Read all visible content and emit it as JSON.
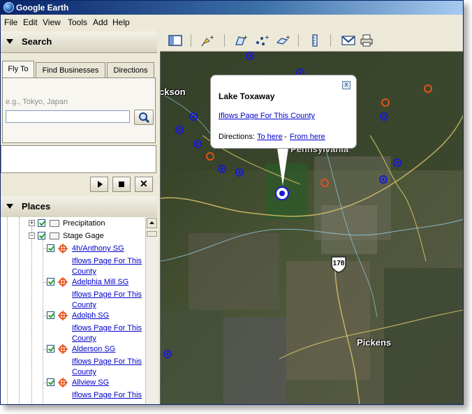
{
  "window": {
    "title": "Google Earth"
  },
  "menu": [
    "File",
    "Edit",
    "View",
    "Tools",
    "Add",
    "Help"
  ],
  "search": {
    "header": "Search",
    "tabs": [
      "Fly To",
      "Find Businesses",
      "Directions"
    ],
    "hint": "e.g., Tokyo, Japan",
    "input_value": ""
  },
  "places": {
    "header": "Places",
    "folders": [
      "Precipitation",
      "Stage Gage"
    ],
    "items": [
      {
        "name": "4h/Anthony SG",
        "link1": "Iflows Page For This",
        "link2": "County"
      },
      {
        "name": "Adelphia Mill SG",
        "link1": "Iflows Page For This",
        "link2": "County"
      },
      {
        "name": "Adolph SG",
        "link1": "Iflows Page For This",
        "link2": "County"
      },
      {
        "name": "Alderson SG",
        "link1": "Iflows Page For This",
        "link2": "County"
      },
      {
        "name": "Allview SG",
        "link1": "Iflows Page For This",
        "link2": ""
      }
    ]
  },
  "balloon": {
    "title": "Lake Toxaway",
    "link": "Iflows Page For This County",
    "directions_label": "Directions:",
    "to_here": "To here",
    "separator": "-",
    "from_here": "From here"
  },
  "map": {
    "labels": [
      "ckson",
      "Pennsylvania",
      "Pickens"
    ],
    "route_shield": "178"
  },
  "colors": {
    "link": "#0000cc",
    "title_bar": "#0a246a",
    "gage_marker": "#e8501a",
    "precip_marker": "#1a1acc"
  }
}
